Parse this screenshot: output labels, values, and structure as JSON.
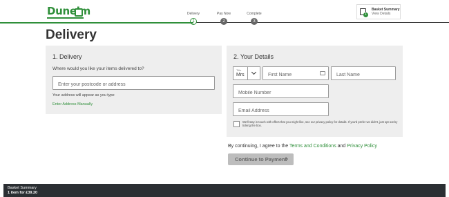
{
  "header": {
    "brand": "Dunelm",
    "steps": [
      {
        "label": "Delivery",
        "number": "1",
        "state": "active"
      },
      {
        "label": "Pay Now",
        "number": "2",
        "state": "inactive"
      },
      {
        "label": "Complete",
        "number": "3",
        "state": "inactive"
      }
    ],
    "basket": {
      "title": "Basket Summary",
      "subtitle": "View Details",
      "count": "1"
    }
  },
  "page_title": "Delivery",
  "delivery_section": {
    "title": "1. Delivery",
    "question": "Where would you like your items delivered to?",
    "postcode_placeholder": "Enter your postcode or address",
    "address_hint": "Your address will appear as you type",
    "manual_link": "Enter Address Manually"
  },
  "details_section": {
    "title": "2. Your Details",
    "title_field_label": "Title",
    "title_value": "Mrs",
    "first_name_placeholder": "First Name",
    "last_name_placeholder": "Last Name",
    "mobile_placeholder": "Mobile Number",
    "email_placeholder": "Email Address",
    "consent_text": "We'll stay in touch with offers that you might like, see our privacy policy for details. If you'd prefer we didn't, just opt out by ticking the box."
  },
  "terms": {
    "prefix": "By continuing, I agree to the ",
    "terms_link": "Terms and Conditions",
    "and": " and ",
    "privacy_link": "Privacy Policy"
  },
  "continue_label": "Continue to Payment",
  "bottom_bar": {
    "title": "Basket Summary",
    "summary": "1 item for £39.20"
  },
  "colors": {
    "brand_green": "#2f8f3a",
    "panel_bg": "#eeeeee",
    "bar_bg": "#2b2f33"
  }
}
